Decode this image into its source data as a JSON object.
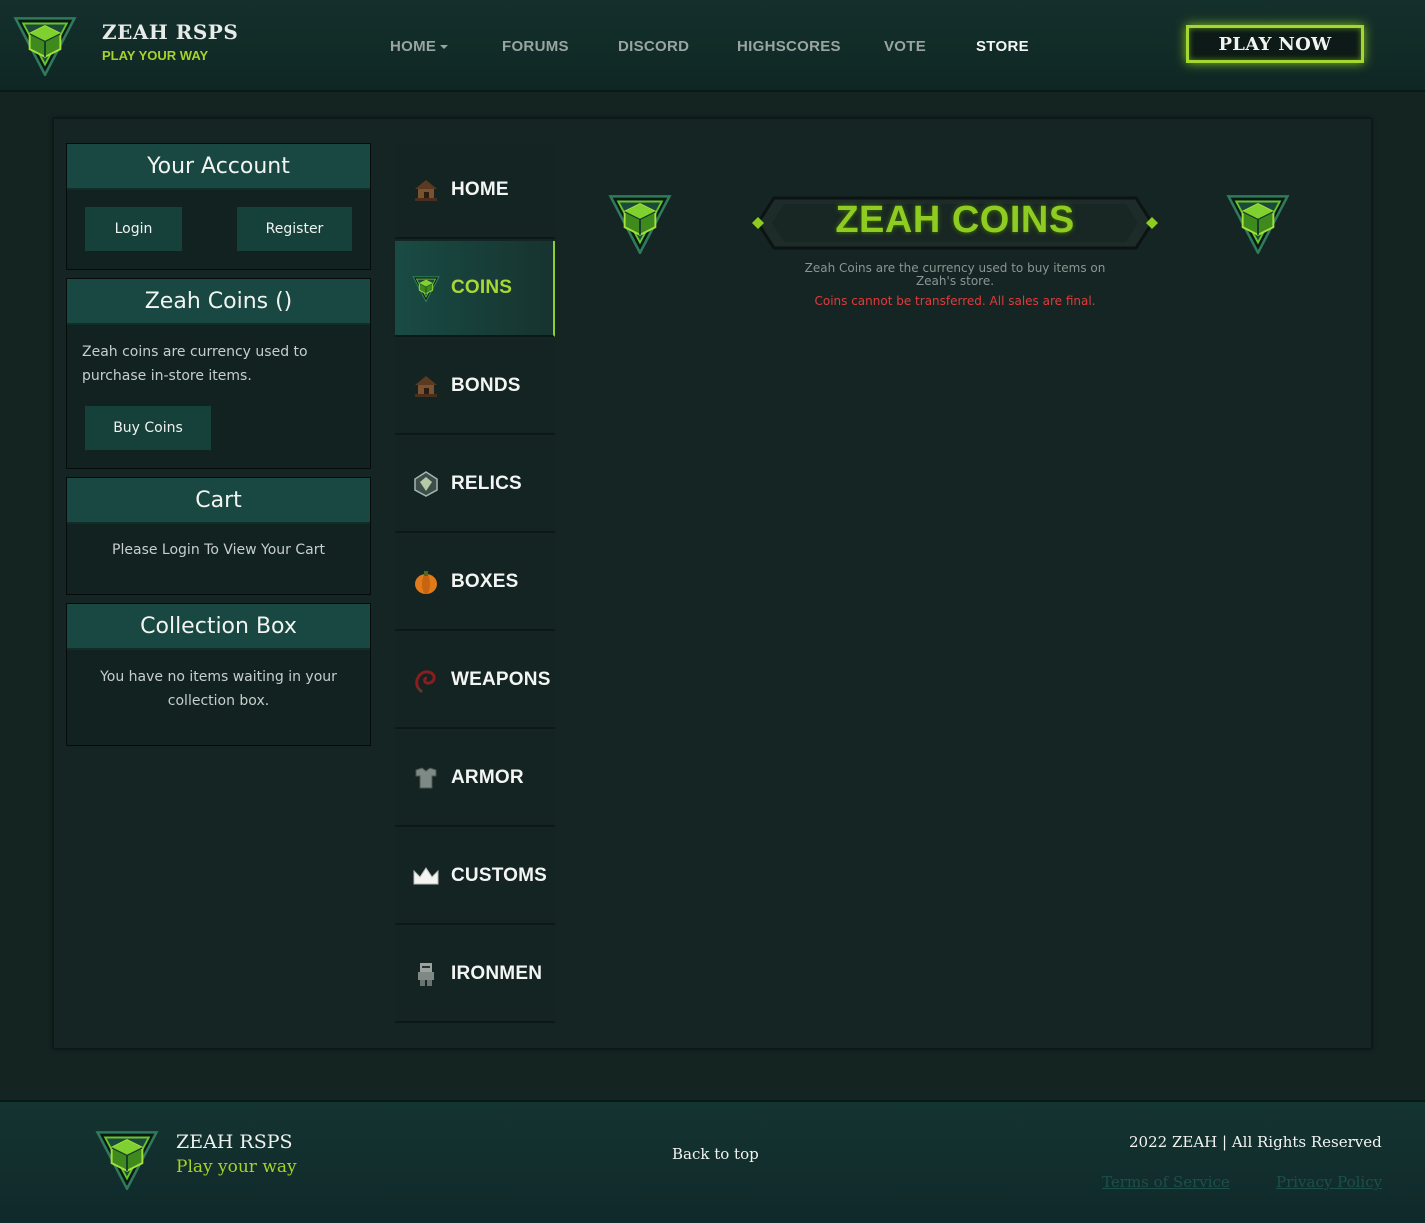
{
  "header": {
    "brand_title": "ZEAH RSPS",
    "brand_tagline": "PLAY YOUR WAY",
    "nav": [
      {
        "label": "HOME",
        "has_dropdown": true,
        "active": false
      },
      {
        "label": "FORUMS",
        "active": false
      },
      {
        "label": "DISCORD",
        "active": false
      },
      {
        "label": "HIGHSCORES",
        "active": false
      },
      {
        "label": "VOTE",
        "active": false
      },
      {
        "label": "STORE",
        "active": true
      }
    ],
    "play_button": "PLAY NOW"
  },
  "sidebar": {
    "account": {
      "title": "Your Account",
      "login": "Login",
      "register": "Register"
    },
    "coins": {
      "title": "Zeah Coins ()",
      "text": "Zeah coins are currency used to purchase in-store items.",
      "buy": "Buy Coins"
    },
    "cart": {
      "title": "Cart",
      "text": "Please Login To View Your Cart"
    },
    "collection": {
      "title": "Collection Box",
      "text": "You have no items waiting in your collection box."
    }
  },
  "categories": [
    {
      "label": "HOME",
      "icon": "house-icon",
      "active": false
    },
    {
      "label": "COINS",
      "icon": "zeah-emblem-icon",
      "active": true
    },
    {
      "label": "BONDS",
      "icon": "house-icon",
      "active": false
    },
    {
      "label": "RELICS",
      "icon": "relic-icon",
      "active": false
    },
    {
      "label": "BOXES",
      "icon": "pumpkin-box-icon",
      "active": false
    },
    {
      "label": "WEAPONS",
      "icon": "whip-icon",
      "active": false
    },
    {
      "label": "ARMOR",
      "icon": "platebody-icon",
      "active": false
    },
    {
      "label": "CUSTOMS",
      "icon": "crown-icon",
      "active": false
    },
    {
      "label": "IRONMEN",
      "icon": "ironman-icon",
      "active": false
    }
  ],
  "content": {
    "banner_title": "ZEAH COINS",
    "description": "Zeah Coins are the currency used to buy items on Zeah's store.",
    "warning": "Coins cannot be transferred. All sales are final."
  },
  "footer": {
    "brand_title": "ZEAH RSPS",
    "brand_tagline": "Play your way",
    "back_to_top": "Back to top",
    "copyright": "2022 ZEAH | All Rights Reserved",
    "terms": "Terms of Service",
    "privacy": "Privacy Policy"
  },
  "colors": {
    "accent_green": "#a6d22a",
    "panel_teal": "#184841",
    "warning_red": "#e33a3a"
  }
}
